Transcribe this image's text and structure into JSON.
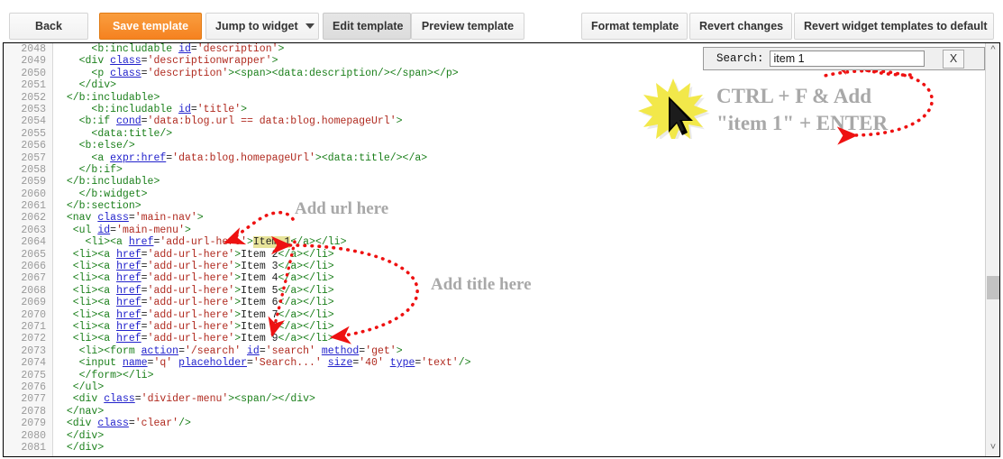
{
  "toolbar": {
    "back": "Back",
    "save_template": "Save template",
    "jump_to_widget": "Jump to widget",
    "edit_template": "Edit template",
    "preview_template": "Preview template",
    "format_template": "Format template",
    "revert_changes": "Revert changes",
    "revert_widget_templates": "Revert widget templates to default",
    "accent_color": "#f58220"
  },
  "find_bar": {
    "label": "Search:",
    "value": "item 1",
    "placeholder": "",
    "close_label": "X"
  },
  "annotations": {
    "ctrl_f_line1": "CTRL + F & Add",
    "ctrl_f_line2": "\"item 1\" + ENTER",
    "add_url": "Add url here",
    "add_title": "Add title here",
    "arrow_color": "#ee1111",
    "text_color": "#a8a8a8"
  },
  "editor": {
    "first_line": 2048,
    "last_line": 2081,
    "highlight_term": "Item 1",
    "lines": [
      {
        "n": 2048,
        "code": "      <b:includable id='description'>"
      },
      {
        "n": 2049,
        "code": "    <div class='descriptionwrapper'>"
      },
      {
        "n": 2050,
        "code": "      <p class='description'><span><data:description/></span></p>"
      },
      {
        "n": 2051,
        "code": "    </div>"
      },
      {
        "n": 2052,
        "code": "  </b:includable>"
      },
      {
        "n": 2053,
        "code": "      <b:includable id='title'>"
      },
      {
        "n": 2054,
        "code": "    <b:if cond='data:blog.url == data:blog.homepageUrl'>"
      },
      {
        "n": 2055,
        "code": "      <data:title/>"
      },
      {
        "n": 2056,
        "code": "    <b:else/>"
      },
      {
        "n": 2057,
        "code": "      <a expr:href='data:blog.homepageUrl'><data:title/></a>"
      },
      {
        "n": 2058,
        "code": "    </b:if>"
      },
      {
        "n": 2059,
        "code": "  </b:includable>"
      },
      {
        "n": 2060,
        "code": "    </b:widget>"
      },
      {
        "n": 2061,
        "code": "  </b:section>"
      },
      {
        "n": 2062,
        "code": "  <nav class='main-nav'>"
      },
      {
        "n": 2063,
        "code": "   <ul id='main-menu'>"
      },
      {
        "n": 2064,
        "code": "     <li><a href='add-url-here'>Item 1</a></li>"
      },
      {
        "n": 2065,
        "code": "   <li><a href='add-url-here'>Item 2</a></li>"
      },
      {
        "n": 2066,
        "code": "   <li><a href='add-url-here'>Item 3</a></li>"
      },
      {
        "n": 2067,
        "code": "   <li><a href='add-url-here'>Item 4</a></li>"
      },
      {
        "n": 2068,
        "code": "   <li><a href='add-url-here'>Item 5</a></li>"
      },
      {
        "n": 2069,
        "code": "   <li><a href='add-url-here'>Item 6</a></li>"
      },
      {
        "n": 2070,
        "code": "   <li><a href='add-url-here'>Item 7</a></li>"
      },
      {
        "n": 2071,
        "code": "   <li><a href='add-url-here'>Item 8</a></li>"
      },
      {
        "n": 2072,
        "code": "   <li><a href='add-url-here'>Item 9</a></li>"
      },
      {
        "n": 2073,
        "code": "    <li><form action='/search' id='search' method='get'>"
      },
      {
        "n": 2074,
        "code": "    <input name='q' placeholder='Search...' size='40' type='text'/>"
      },
      {
        "n": 2075,
        "code": "    </form></li>"
      },
      {
        "n": 2076,
        "code": "   </ul>"
      },
      {
        "n": 2077,
        "code": "   <div class='divider-menu'><span/></div>"
      },
      {
        "n": 2078,
        "code": "  </nav>"
      },
      {
        "n": 2079,
        "code": "  <div class='clear'/>"
      },
      {
        "n": 2080,
        "code": "  </div>"
      },
      {
        "n": 2081,
        "code": "  </div>"
      }
    ]
  },
  "scrollbar": {
    "up_icon": "chevron-up-icon",
    "down_icon": "chevron-down-icon"
  }
}
